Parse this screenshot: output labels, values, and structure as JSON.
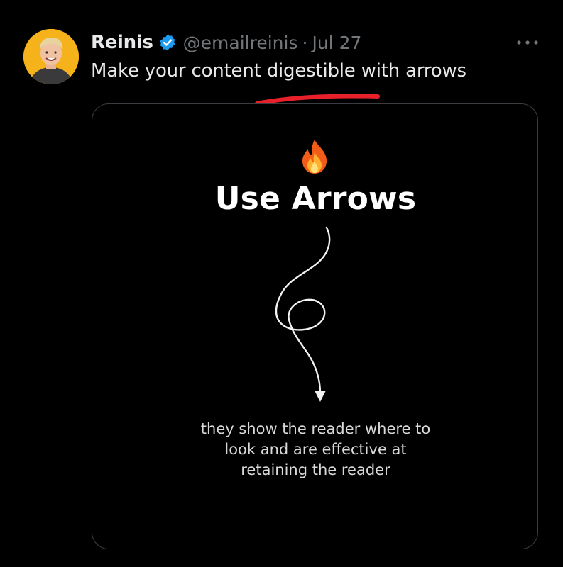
{
  "tweet": {
    "author_name": "Reinis",
    "verified": true,
    "handle": "@emailreinis",
    "separator": "·",
    "timestamp": "Jul 27",
    "text": "Make your content digestible with arrows",
    "more_icon": "more-horizontal-icon"
  },
  "media": {
    "emoji": "fire",
    "title": "Use Arrows",
    "body_lines": [
      "they show the reader where to",
      "look and are effective at",
      "retaining the reader"
    ]
  },
  "colors": {
    "background": "#000000",
    "primary_text": "#e7e9ea",
    "secondary_text": "#71767b",
    "verified_blue": "#1d9bf0",
    "highlight_red": "#e8202a",
    "avatar_bg": "#f5b21b"
  }
}
